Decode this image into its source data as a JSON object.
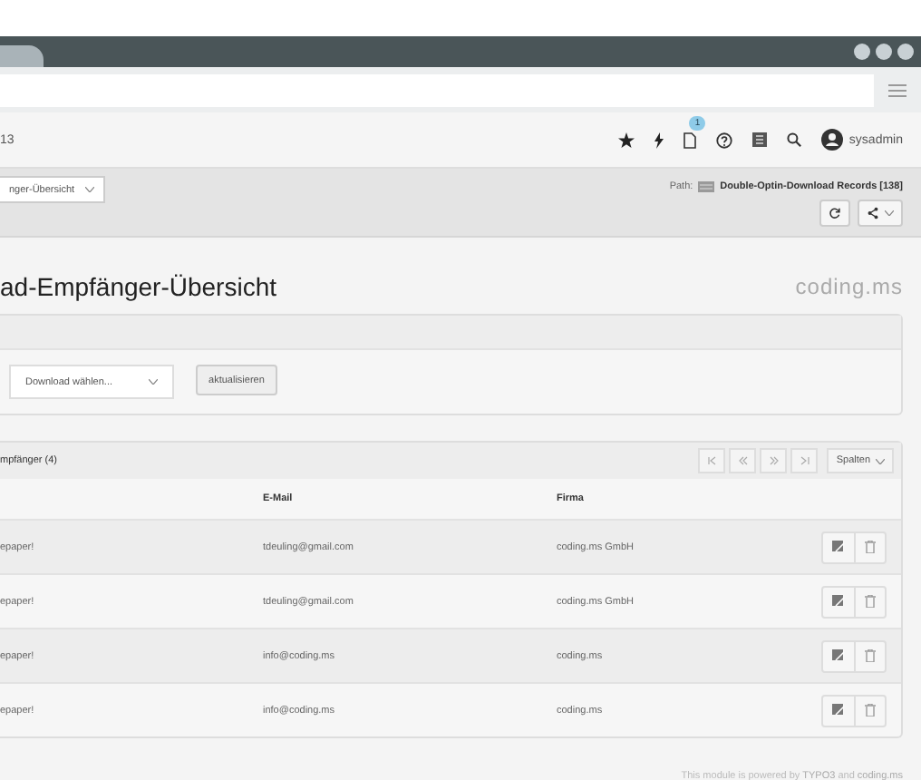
{
  "toolbar": {
    "crumb": "13",
    "notification_count": "1",
    "username": "sysadmin"
  },
  "docheader": {
    "module_menu": "nger-Übersicht",
    "path_label": "Path:",
    "path_value": "Double-Optin-Download Records [138]"
  },
  "title": "ad-Empfänger-Übersicht",
  "logo": "coding.ms",
  "filter": {
    "download_select": "Download wählen...",
    "refresh_button": "aktualisieren"
  },
  "table": {
    "title": "mpfänger (4)",
    "columns_button": "Spalten",
    "columns": [
      "",
      "E-Mail",
      "Firma"
    ],
    "rows": [
      {
        "column_1": "epaper!",
        "email": "tdeuling@gmail.com",
        "firma": "coding.ms GmbH"
      },
      {
        "column_1": "epaper!",
        "email": "tdeuling@gmail.com",
        "firma": "coding.ms GmbH"
      },
      {
        "column_1": "epaper!",
        "email": "info@coding.ms",
        "firma": "coding.ms"
      },
      {
        "column_1": "epaper!",
        "email": "info@coding.ms",
        "firma": "coding.ms"
      }
    ]
  },
  "footer": {
    "text_before": "This module is powered by",
    "link_1": "TYPO3",
    "text_middle": "and",
    "link_2": "coding.ms"
  }
}
